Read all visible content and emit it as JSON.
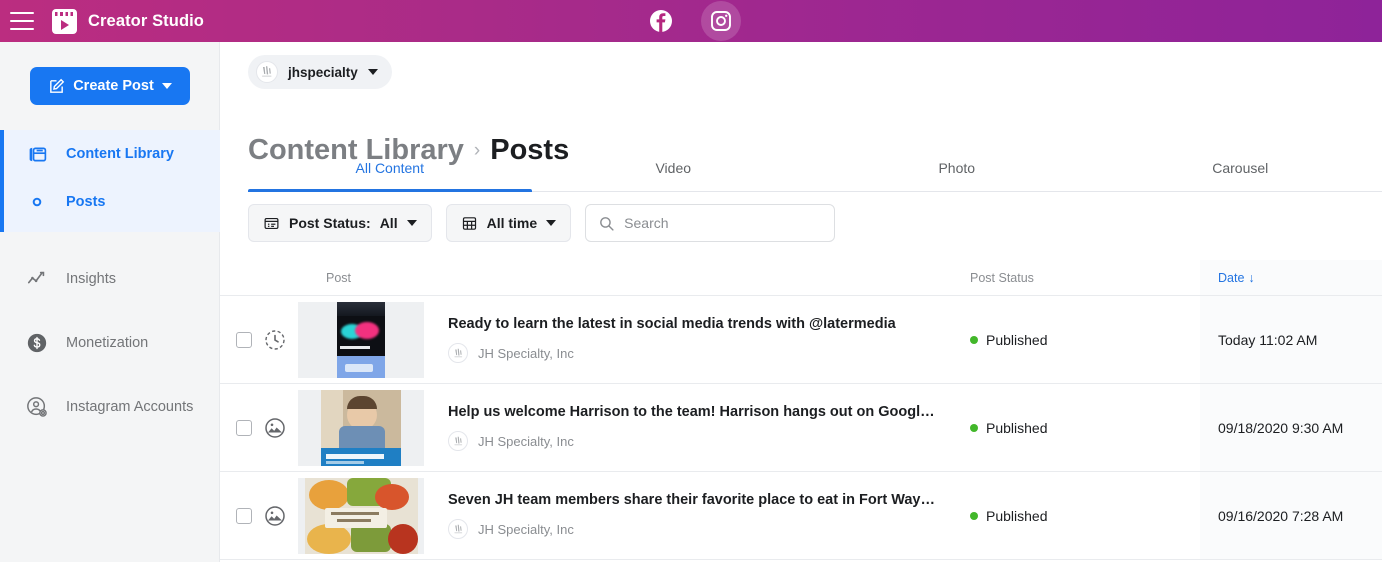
{
  "topbar": {
    "menu_icon": "hamburger-menu-icon",
    "brand": "Creator Studio",
    "brand_icon": "creator-studio-clapperboard-icon",
    "apps": [
      {
        "name": "facebook",
        "icon": "facebook-icon",
        "label": "Facebook",
        "selected": false
      },
      {
        "name": "instagram",
        "icon": "instagram-icon",
        "label": "Instagram",
        "selected": true
      }
    ],
    "gradient_from": "#bb2d80",
    "gradient_to": "#8e2399"
  },
  "sidebar": {
    "create_post": {
      "label": "Create Post",
      "icon": "compose-pencil-icon",
      "caret": "chevron-down-icon",
      "color": "#1877f2"
    },
    "active_group": [
      {
        "label": "Content Library",
        "icon": "content-library-icon",
        "active": true
      },
      {
        "label": "Posts",
        "icon": "posts-circle-icon",
        "active": true
      }
    ],
    "items": [
      {
        "label": "Insights",
        "icon": "insights-chart-icon"
      },
      {
        "label": "Monetization",
        "icon": "monetization-dollar-icon"
      },
      {
        "label": "Instagram Accounts",
        "icon": "instagram-accounts-icon"
      }
    ]
  },
  "account": {
    "name": "jhspecialty",
    "avatar_icon": "account-avatar-icon",
    "caret": "chevron-down-icon"
  },
  "breadcrumb": {
    "parent": "Content Library",
    "separator": "›",
    "current": "Posts"
  },
  "tabs": [
    {
      "label": "All Content",
      "active": true
    },
    {
      "label": "Video",
      "active": false
    },
    {
      "label": "Photo",
      "active": false
    },
    {
      "label": "Carousel",
      "active": false
    }
  ],
  "filters": {
    "post_status": {
      "label": "Post Status:",
      "value": "All",
      "icon": "list-card-icon",
      "caret": "chevron-down-icon"
    },
    "time_range": {
      "value": "All time",
      "icon": "calendar-grid-icon",
      "caret": "chevron-down-icon"
    },
    "search": {
      "placeholder": "Search",
      "value": "",
      "icon": "search-icon"
    }
  },
  "table": {
    "headers": {
      "post": "Post",
      "status": "Post Status",
      "date": "Date",
      "sort_arrow": "↓"
    },
    "rows": [
      {
        "type_icon": "story-clock-icon",
        "title": "Ready to learn the latest in social media trends with @latermedia",
        "page": "JH Specialty, Inc",
        "status": "Published",
        "status_color": "#42b72a",
        "date": "Today 11:02 AM"
      },
      {
        "type_icon": "photo-image-icon",
        "title": "Help us welcome Harrison to the team! Harrison hangs out on Google and s…",
        "page": "JH Specialty, Inc",
        "status": "Published",
        "status_color": "#42b72a",
        "date": "09/18/2020 9:30 AM"
      },
      {
        "type_icon": "photo-image-icon",
        "title": "Seven JH team members share their favorite place to eat in Fort Wayne. Fro…",
        "page": "JH Specialty, Inc",
        "status": "Published",
        "status_color": "#42b72a",
        "date": "09/16/2020 7:28 AM"
      }
    ]
  }
}
